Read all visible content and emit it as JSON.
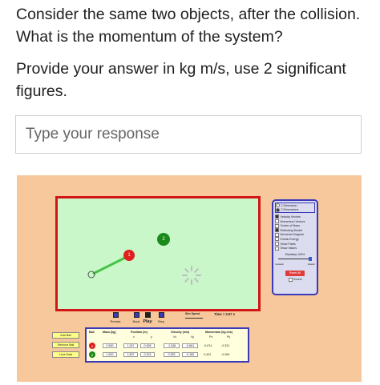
{
  "question": {
    "prompt": "Consider the same two objects, after the collision. What is the momentum of the system?",
    "instructions": "Provide your answer in kg m/s, use 2 significant figures."
  },
  "response": {
    "placeholder": "Type your response"
  },
  "sim": {
    "ball1_label": "1",
    "ball2_label": "2",
    "panel": {
      "dim1": "1 Dimension",
      "dim2": "2 Dimensions",
      "velocity_vectors": "Velocity Vectors",
      "momentum_vectors": "Momentum Vectors",
      "center_of_mass": "Center of Mass",
      "reflecting_border": "Reflecting Border",
      "momenta_diagram": "Momenta Diagram",
      "kinetic_energy": "Kinetic Energy",
      "show_paths": "Show Paths",
      "show_values": "Show Values",
      "elasticity": "Elasticity 100%",
      "inelastic": "Inelastic",
      "elastic": "Elastic",
      "reset_all": "Reset All",
      "sound": "Sound"
    },
    "controls": {
      "restart": "Restart",
      "back": "Back",
      "play": "Play",
      "step": "Step",
      "sim_speed": "Sim Speed",
      "time": "Time = 0.67 s"
    },
    "side_buttons": {
      "add_ball": "Add Ball",
      "remove_ball": "Remove Ball",
      "less_data": "Less Data"
    },
    "table": {
      "headers": {
        "ball": "Ball",
        "mass": "Mass (kg)",
        "position": "Position (m)",
        "velocity": "Velocity (m/s)",
        "momentum": "Momentum (kg m/s)",
        "x": "x",
        "y": "y",
        "vx": "Vx",
        "vy": "Vy",
        "px": "Px",
        "py": "Py"
      },
      "rows": [
        {
          "ball": "1",
          "mass": "0.500",
          "x": "1.247",
          "y": "0.928",
          "vx": "-1.348",
          "vy": "-0.661",
          "px": "-0.674",
          "py": "-0.331"
        },
        {
          "ball": "2",
          "mass": "1.500",
          "x": "1.807",
          "y": "0.224",
          "vx": "0.283",
          "vy": "-0.180",
          "px": "0.424",
          "py": "-0.269"
        }
      ]
    }
  }
}
